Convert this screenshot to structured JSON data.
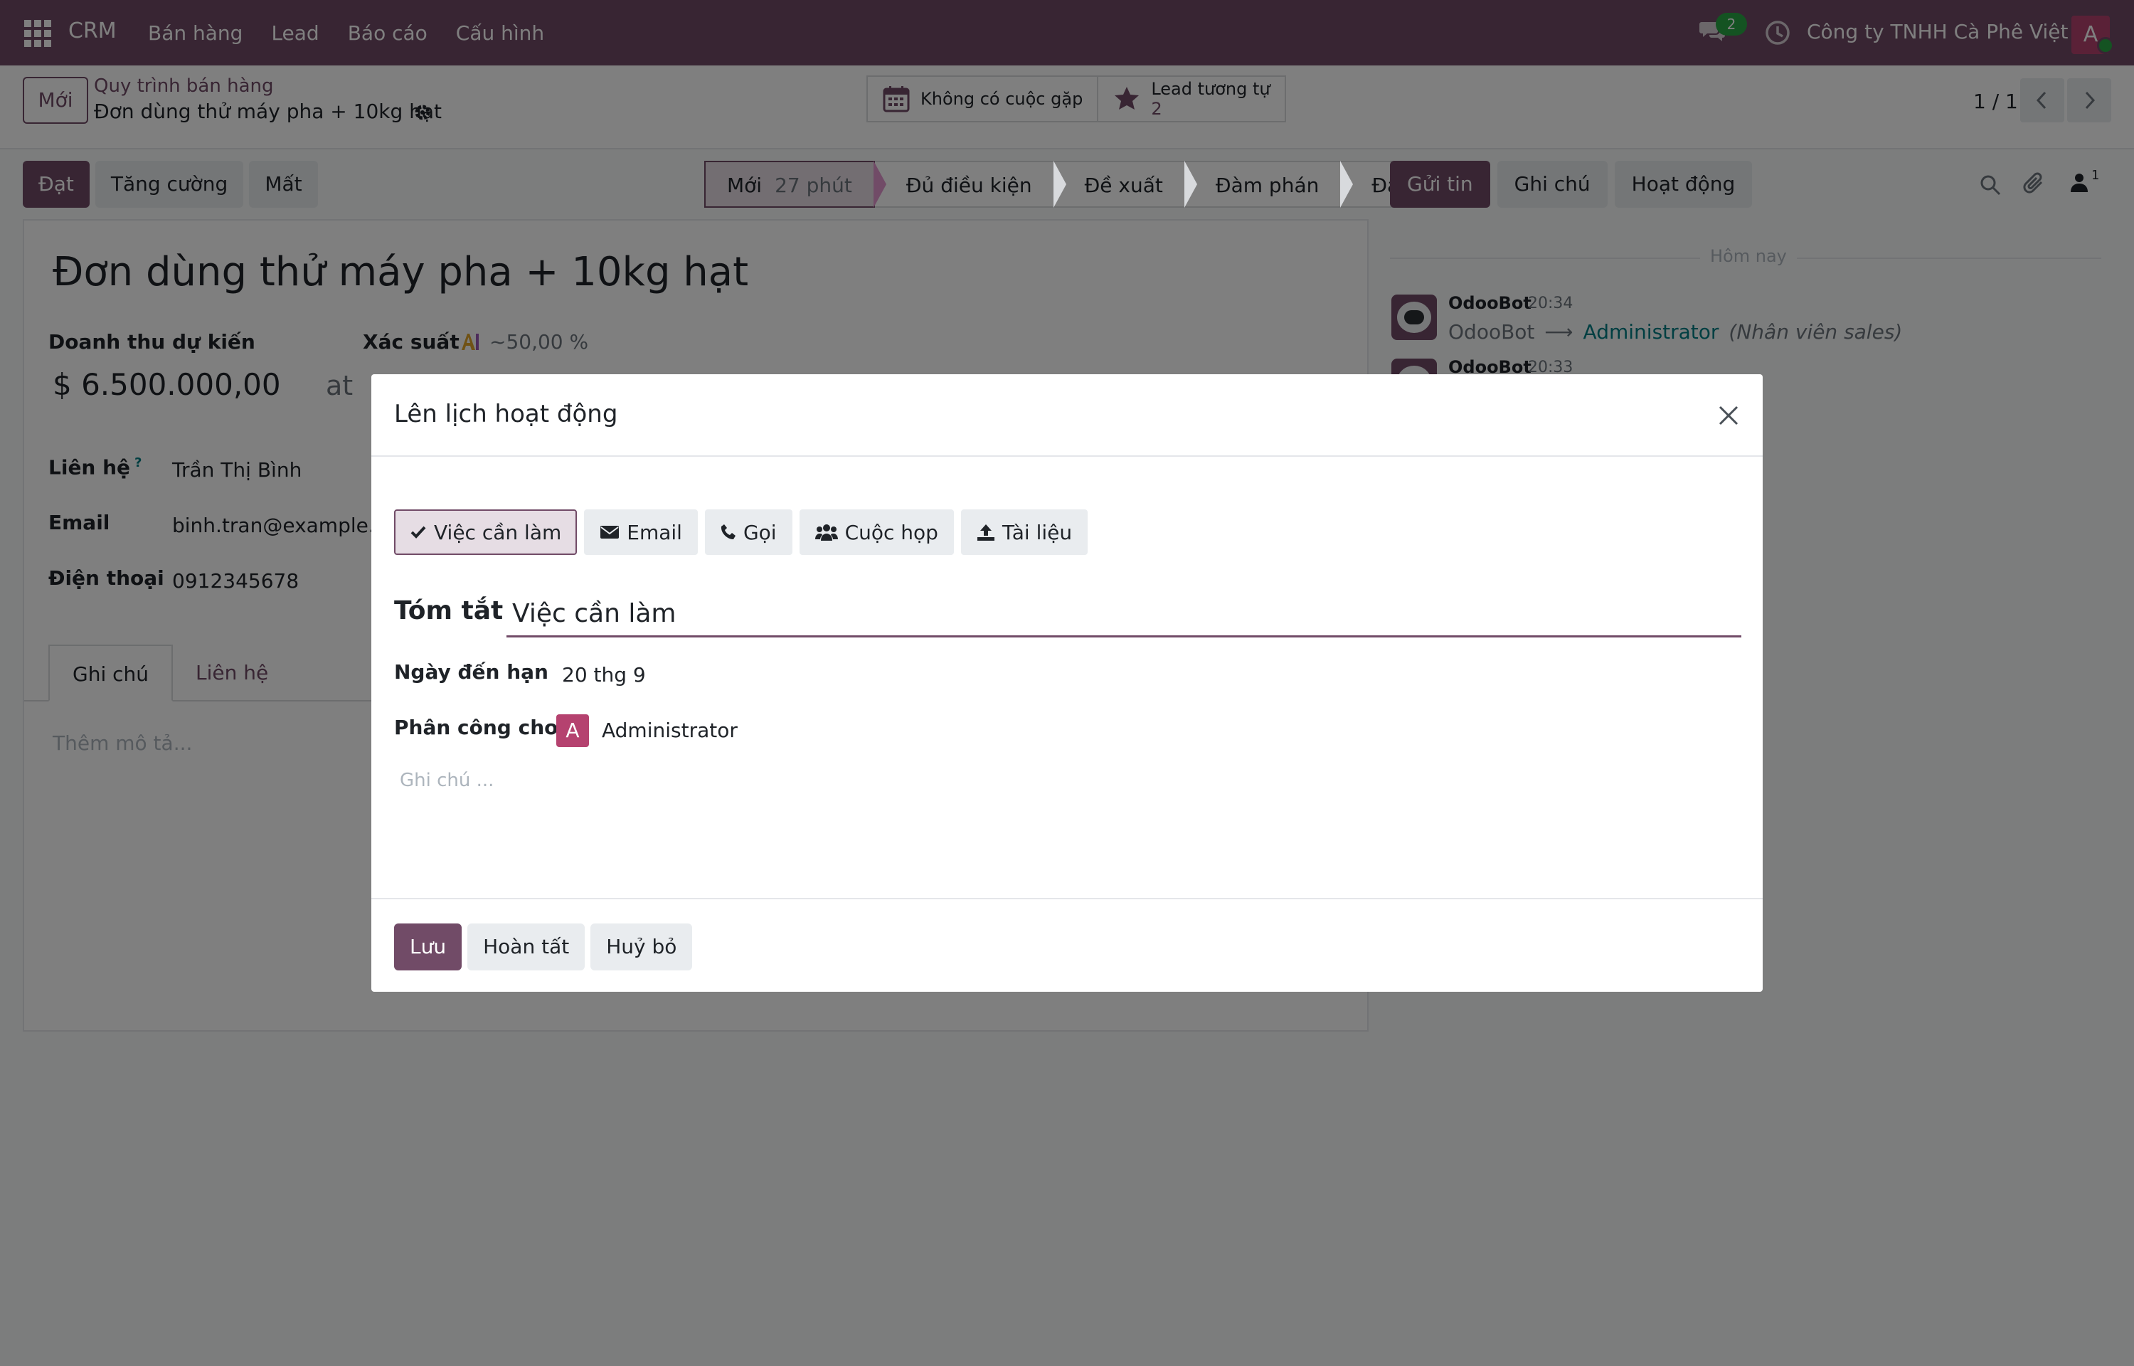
{
  "navbar": {
    "brand": "CRM",
    "menu": [
      "Bán hàng",
      "Lead",
      "Báo cáo",
      "Cấu hình"
    ],
    "chat_count": "2",
    "company": "Công ty TNHH Cà Phê Việt",
    "user_initial": "A",
    "accent": "#714b67"
  },
  "control": {
    "new_label": "Mới",
    "breadcrumb_parent": "Quy trình bán hàng",
    "breadcrumb_current": "Đơn dùng thử máy pha + 10kg hạt",
    "smart_meeting": "Không có cuộc gặp",
    "smart_similar_label": "Lead tương tự",
    "smart_similar_count": "2",
    "pager": "1 / 1"
  },
  "form": {
    "status_buttons": [
      "Đạt",
      "Tăng cường",
      "Mất"
    ],
    "stages": [
      {
        "label": "Mới",
        "duration": "27 phút"
      },
      {
        "label": "Đủ điều kiện"
      },
      {
        "label": "Đề xuất"
      },
      {
        "label": "Đàm phán"
      },
      {
        "label": "Đạt"
      }
    ],
    "title": "Đơn dùng thử máy pha + 10kg hạt",
    "revenue_label": "Doanh thu dự kiến",
    "revenue_value": "$ 6.500.000,00",
    "at_text": "at",
    "probability_label": "Xác suất",
    "probability_value": "~50,00 %",
    "contact_label": "Liên hệ",
    "contact_help": "?",
    "contact_value": "Trần Thị Bình",
    "email_label": "Email",
    "email_value": "binh.tran@example.vn",
    "phone_label": "Điện thoại",
    "phone_value": "0912345678",
    "tabs": [
      "Ghi chú",
      "Liên hệ"
    ],
    "description_placeholder": "Thêm mô tả..."
  },
  "chatter": {
    "buttons": [
      "Gửi tin",
      "Ghi chú",
      "Hoạt động"
    ],
    "follower_count": "1",
    "date_separator": "Hôm nay",
    "messages": [
      {
        "author": "OdooBot",
        "time": "20:34",
        "from": "OdooBot",
        "arrow": "⟶",
        "to": "Administrator",
        "role": "(Nhân viên sales)"
      },
      {
        "author": "OdooBot",
        "time": "20:33"
      }
    ]
  },
  "dialog": {
    "title": "Lên lịch hoạt động",
    "activity_types": [
      "Việc cần làm",
      "Email",
      "Gọi",
      "Cuộc họp",
      "Tài liệu"
    ],
    "summary_label": "Tóm tắt",
    "summary_value": "Việc cần làm",
    "due_label": "Ngày đến hạn",
    "due_value": "20 thg 9",
    "assign_label": "Phân công cho",
    "assign_initial": "A",
    "assign_value": "Administrator",
    "note_placeholder": "Ghi chú ...",
    "footer_buttons": [
      "Lưu",
      "Hoàn tất",
      "Huỷ bỏ"
    ]
  }
}
